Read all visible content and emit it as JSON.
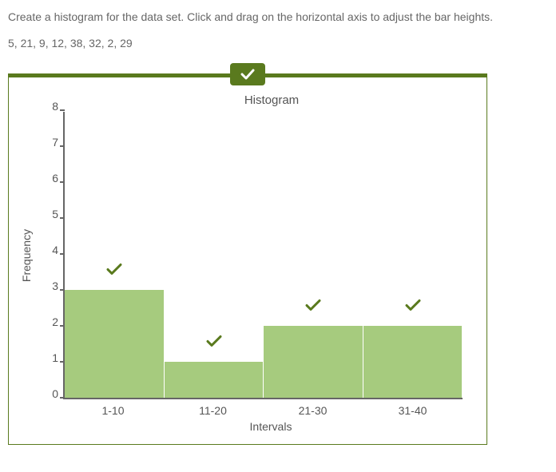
{
  "instruction": "Create a histogram for the data set. Click and drag on the horizontal axis to adjust the bar heights.",
  "dataset": "5, 21, 9, 12, 38, 32, 2, 29",
  "badge_icon": "check-icon",
  "chart_data": {
    "type": "bar",
    "title": "Histogram",
    "xlabel": "Intervals",
    "ylabel": "Frequency",
    "ylim": [
      0,
      8
    ],
    "yticks": [
      0,
      1,
      2,
      3,
      4,
      5,
      6,
      7,
      8
    ],
    "categories": [
      "1-10",
      "11-20",
      "21-30",
      "31-40"
    ],
    "values": [
      3,
      1,
      2,
      2
    ],
    "correct_marks": [
      true,
      true,
      true,
      true
    ]
  },
  "colors": {
    "accent": "#5a7a1e",
    "bar_fill": "#a6cb7e"
  }
}
